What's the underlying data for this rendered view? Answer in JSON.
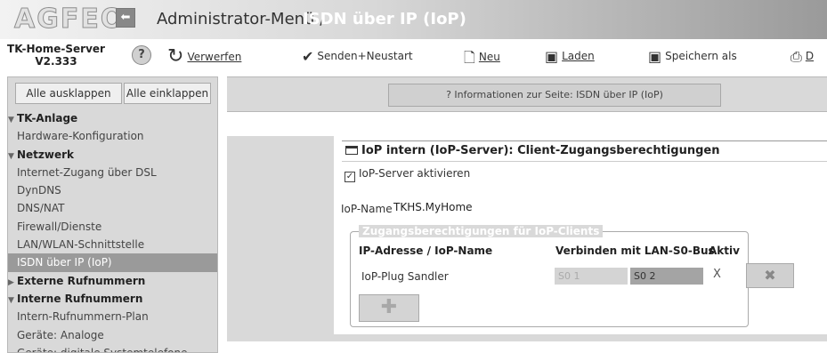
{
  "header": {
    "logo": "AGFEO",
    "back_icon": "arrow-left-icon",
    "title_prefix": "Administrator-Menü /",
    "title_page": "ISDN über IP (IoP)"
  },
  "toolbar": {
    "server_name_line1": "TK-Home-Server",
    "server_name_line2": "V2.333",
    "help": "?",
    "discard": "Verwerfen",
    "send_restart": "Senden+Neustart",
    "new": "Neu",
    "load": "Laden",
    "save_as": "Speichern als",
    "print": "D"
  },
  "sidebar": {
    "expand_all": "Alle ausklappen",
    "collapse_all": "Alle einklappen",
    "items": [
      {
        "label": "TK-Anlage",
        "type": "group",
        "expanded": true
      },
      {
        "label": "Hardware-Konfiguration",
        "type": "item"
      },
      {
        "label": "Netzwerk",
        "type": "group",
        "expanded": true
      },
      {
        "label": "Internet-Zugang über DSL",
        "type": "item"
      },
      {
        "label": "DynDNS",
        "type": "item"
      },
      {
        "label": "DNS/NAT",
        "type": "item"
      },
      {
        "label": "Firewall/Dienste",
        "type": "item"
      },
      {
        "label": "LAN/WLAN-Schnittstelle",
        "type": "item"
      },
      {
        "label": "ISDN über IP (IoP)",
        "type": "item",
        "active": true
      },
      {
        "label": "Externe Rufnummern",
        "type": "group",
        "expanded": false
      },
      {
        "label": "Interne Rufnummern",
        "type": "group",
        "expanded": true
      },
      {
        "label": "Intern-Rufnummern-Plan",
        "type": "item"
      },
      {
        "label": "Geräte: Analoge",
        "type": "item"
      },
      {
        "label": "Geräte: digitale Systemtelefone",
        "type": "item"
      }
    ]
  },
  "main": {
    "info_button": "? Informationen zur Seite: ISDN über IP (IoP)",
    "section_title": "IoP intern (IoP-Server): Client-Zugangsberechtigungen",
    "enable_label": "IoP-Server aktivieren",
    "enable_checked": true,
    "iop_name_label": "IoP-Name",
    "iop_name_value": "TKHS.MyHome",
    "clients_legend": "Zugangsberechtigungen für IoP-Clients",
    "col_address": "IP-Adresse / IoP-Name",
    "col_connect": "Verbinden mit LAN-S0-Bus",
    "col_active": "Aktiv",
    "clients": [
      {
        "name": "IoP-Plug Sandler",
        "s0_1": "S0 1",
        "s0_2": "S0 2",
        "active": "X"
      }
    ]
  }
}
